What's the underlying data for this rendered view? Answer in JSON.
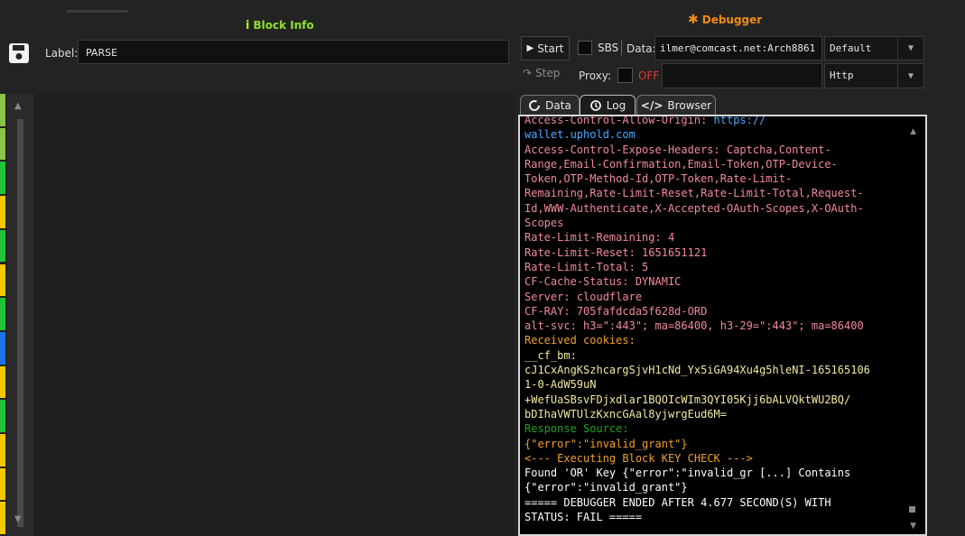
{
  "block_info": {
    "title": "Block Info",
    "label_text": "Label:",
    "label_value": "PARSE"
  },
  "left_strip_colors": [
    "#8bc34a",
    "#8bc34a",
    "#22c33a",
    "#f5c800",
    "#22c33a",
    "#f5c800",
    "#22c33a",
    "#1e73e8",
    "#f5c800",
    "#22c33a",
    "#f5c800",
    "#f5c800",
    "#f5c800"
  ],
  "debugger": {
    "title": "Debugger",
    "start_label": "Start",
    "sbs_label": "SBS",
    "data_label": "Data:",
    "data_value": "ilmer@comcast.net:Arch8861",
    "mode_select": "Default",
    "step_label": "Step",
    "proxy_label": "Proxy:",
    "proxy_state": "OFF",
    "proxy_type_select": "Http",
    "tabs": [
      {
        "label": "Data",
        "icon": "refresh-icon"
      },
      {
        "label": "Log",
        "icon": "history-icon"
      },
      {
        "label": "Browser",
        "icon": "code-icon"
      }
    ]
  },
  "colors": {
    "block_accent": "#8ee02a",
    "debugger_accent": "#f08a1a",
    "log_header": "#f08a9a",
    "log_orange": "#f0a030",
    "log_green": "#20a020",
    "log_yellow": "#f0e8a0",
    "log_link": "#4aa8ff",
    "log_white": "#ffffff",
    "proxy_off": "#e03535"
  },
  "log": [
    {
      "c": "pink",
      "t": "Access-Control-Allow-Origin: ",
      "link": "https://"
    },
    {
      "c": "link",
      "t": "wallet.uphold.com"
    },
    {
      "c": "pink",
      "t": "Access-Control-Expose-Headers: Captcha,Content-"
    },
    {
      "c": "pink",
      "t": "Range,Email-Confirmation,Email-Token,OTP-Device-"
    },
    {
      "c": "pink",
      "t": "Token,OTP-Method-Id,OTP-Token,Rate-Limit-"
    },
    {
      "c": "pink",
      "t": "Remaining,Rate-Limit-Reset,Rate-Limit-Total,Request-"
    },
    {
      "c": "pink",
      "t": "Id,WWW-Authenticate,X-Accepted-OAuth-Scopes,X-OAuth-"
    },
    {
      "c": "pink",
      "t": "Scopes"
    },
    {
      "c": "pink",
      "t": "Rate-Limit-Remaining: 4"
    },
    {
      "c": "pink",
      "t": "Rate-Limit-Reset: 1651651121"
    },
    {
      "c": "pink",
      "t": "Rate-Limit-Total: 5"
    },
    {
      "c": "pink",
      "t": "CF-Cache-Status: DYNAMIC"
    },
    {
      "c": "pink",
      "t": "Server: cloudflare"
    },
    {
      "c": "pink",
      "t": "CF-RAY: 705fafdcda5f628d-ORD"
    },
    {
      "c": "pink",
      "t": "alt-svc: h3=\":443\"; ma=86400, h3-29=\":443\"; ma=86400"
    },
    {
      "c": "orange",
      "t": "Received cookies:"
    },
    {
      "c": "yellow",
      "t": "__cf_bm:"
    },
    {
      "c": "yellow",
      "t": "cJ1CxAngKSzhcargSjvH1cNd_Yx5iGA94Xu4g5hleNI-165165106"
    },
    {
      "c": "yellow",
      "t": "1-0-AdW59uN"
    },
    {
      "c": "yellow",
      "t": "+WefUaSBsvFDjxdlar1BQOIcWIm3QYI05Kjj6bALVQktWU2BQ/"
    },
    {
      "c": "yellow",
      "t": "bDIhaVWTUlzKxncGAal8yjwrgEud6M="
    },
    {
      "c": "green",
      "t": "Response Source:"
    },
    {
      "c": "orange",
      "t": "{\"error\":\"invalid_grant\"}"
    },
    {
      "c": "orange",
      "t": "<--- Executing Block KEY CHECK --->"
    },
    {
      "c": "white",
      "t": "Found 'OR' Key {\"error\":\"invalid_gr [...] Contains"
    },
    {
      "c": "white",
      "t": "{\"error\":\"invalid_grant\"}"
    },
    {
      "c": "white",
      "t": "===== DEBUGGER ENDED AFTER 4.677 SECOND(S) WITH"
    },
    {
      "c": "white",
      "t": "STATUS: FAIL ====="
    }
  ]
}
